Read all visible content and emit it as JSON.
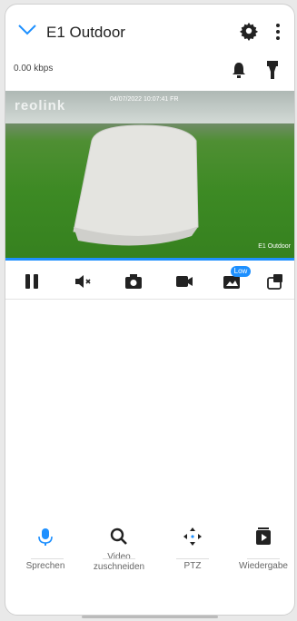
{
  "header": {
    "title": "E1 Outdoor",
    "bitrate": "0.00 kbps"
  },
  "video": {
    "brand_watermark": "reolink",
    "timestamp_overlay": "04/07/2022 10:07:41 FR",
    "device_overlay": "E1 Outdoor"
  },
  "controls": {
    "low_badge": "Low"
  },
  "bottom_nav": {
    "items": [
      {
        "label": "Sprechen",
        "icon": "mic-icon"
      },
      {
        "label": "Video zuschneiden",
        "icon": "search-icon"
      },
      {
        "label": "PTZ",
        "icon": "ptz-move-icon"
      },
      {
        "label": "Wiedergabe",
        "icon": "playback-icon"
      }
    ]
  },
  "colors": {
    "accent": "#1e90ff",
    "text": "#222222"
  }
}
